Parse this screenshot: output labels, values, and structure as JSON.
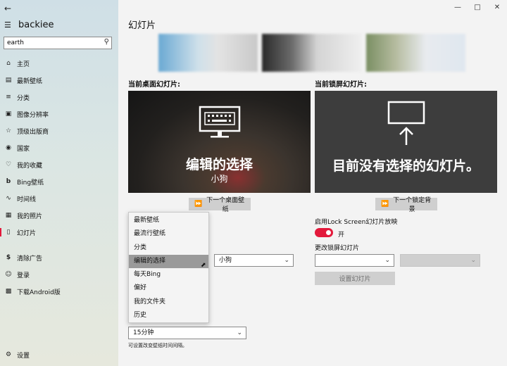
{
  "app": {
    "name": "backiee"
  },
  "search": {
    "value": "earth"
  },
  "nav_items": [
    {
      "icon": "home-icon",
      "label": "主页"
    },
    {
      "icon": "wallpaper-icon",
      "label": "最新壁纸"
    },
    {
      "icon": "list-icon",
      "label": "分类"
    },
    {
      "icon": "resolution-icon",
      "label": "图像分辨率"
    },
    {
      "icon": "publisher-icon",
      "label": "顶级出版商"
    },
    {
      "icon": "globe-icon",
      "label": "国家"
    },
    {
      "icon": "heart-icon",
      "label": "我的收藏"
    },
    {
      "icon": "bing-icon",
      "label": "Bing壁纸"
    },
    {
      "icon": "timeline-icon",
      "label": "时间线"
    },
    {
      "icon": "photos-icon",
      "label": "我的照片"
    },
    {
      "icon": "slideshow-icon",
      "label": "幻灯片"
    }
  ],
  "nav_items2": [
    {
      "icon": "dollar-icon",
      "label": "清除广告"
    },
    {
      "icon": "user-icon",
      "label": "登录"
    },
    {
      "icon": "android-icon",
      "label": "下载Android版"
    }
  ],
  "settings": {
    "label": "设置"
  },
  "page_title": "幻灯片",
  "desktop": {
    "section_label": "当前桌面幻灯片:",
    "preview_title": "编辑的选择",
    "preview_sub": "小狗",
    "next_label": "下一个桌面壁纸"
  },
  "lock": {
    "section_label": "当前锁屏幻灯片:",
    "preview_title": "目前没有选择的幻灯片。",
    "next_label": "下一个锁定背景",
    "enable_label": "启用Lock Screen幻灯片放映",
    "toggle_state": "开",
    "change_label": "更改锁屏幻灯片",
    "set_button": "设置幻灯片"
  },
  "flyout": {
    "items": [
      "最新壁纸",
      "最流行壁纸",
      "分类",
      "编辑的选择",
      "每天Bing",
      "偏好",
      "我的文件夹",
      "历史"
    ],
    "selected": "编辑的选择"
  },
  "sub_select": {
    "value": "小狗"
  },
  "interval": {
    "value": "15分钟",
    "hint": "可设置改变壁纸时间间隔。"
  }
}
